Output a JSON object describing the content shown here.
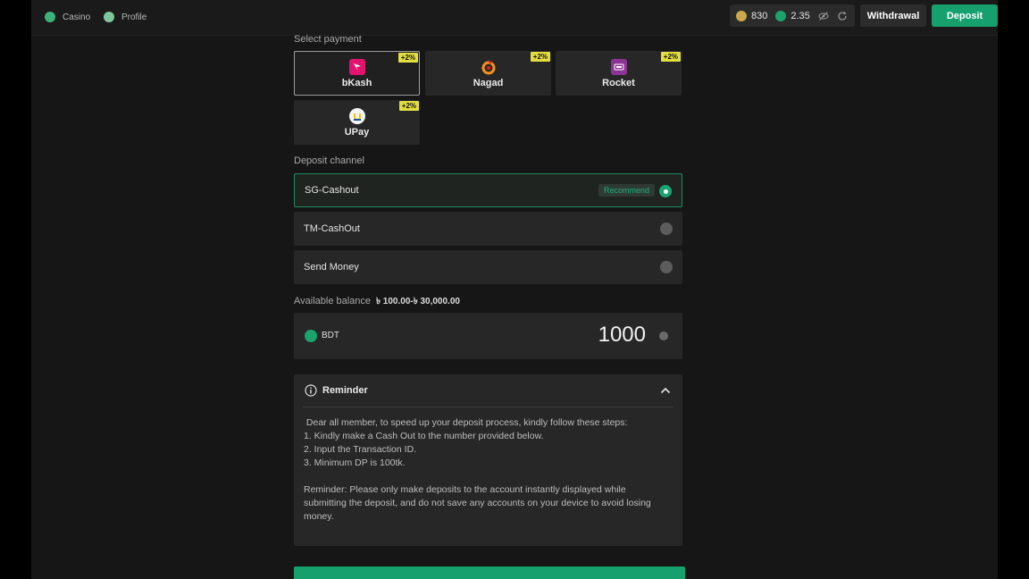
{
  "nav": {
    "casino_label": "Casino",
    "profile_label": "Profile"
  },
  "wallet": {
    "coins": "830",
    "balance": "2.35"
  },
  "header": {
    "withdrawal_label": "Withdrawal",
    "deposit_label": "Deposit"
  },
  "select_payment_label": "Select payment",
  "payments": [
    {
      "name": "bKash",
      "bonus": "+2%",
      "selected": true,
      "color": "#e2136e"
    },
    {
      "name": "Nagad",
      "bonus": "+2%",
      "selected": false,
      "color": "#f6921e"
    },
    {
      "name": "Rocket",
      "bonus": "+2%",
      "selected": false,
      "color": "#8c3494"
    },
    {
      "name": "UPay",
      "bonus": "+2%",
      "selected": false,
      "color": "#f5c400"
    }
  ],
  "deposit_channel_label": "Deposit channel",
  "channels": [
    {
      "name": "SG-Cashout",
      "badge": "Recommend",
      "active": true
    },
    {
      "name": "TM-CashOut",
      "active": false
    },
    {
      "name": "Send Money",
      "active": false
    }
  ],
  "balance": {
    "label": "Available balance",
    "range": "৳ 100.00-৳ 30,000.00"
  },
  "amount": {
    "currency": "BDT",
    "value": "1000"
  },
  "reminder": {
    "title": "Reminder",
    "lines": [
      " Dear all member, to speed up your deposit process, kindly follow these steps:",
      "1. Kindly make a Cash Out to the number provided below.",
      "2. Input the Transaction ID.",
      "3. Minimum DP is 100tk."
    ],
    "note": "Reminder: Please only make deposits to the account instantly displayed while submitting the deposit, and do not save any accounts on your device to avoid losing money."
  },
  "colors": {
    "accent": "#16a06e",
    "bonus": "#e3de3f",
    "background": "#161616"
  }
}
